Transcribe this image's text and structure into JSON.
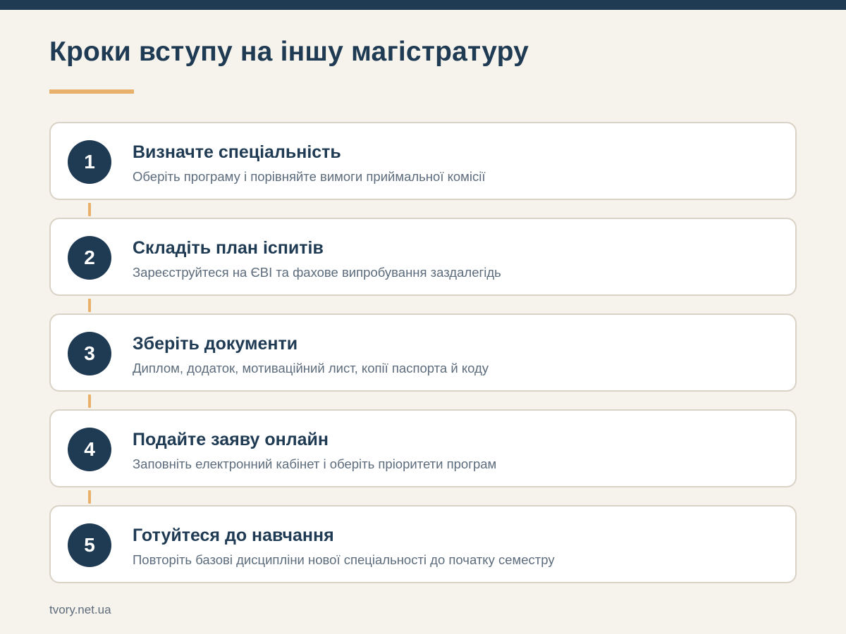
{
  "title": "Кроки вступу на іншу магістратуру",
  "colors": {
    "navy": "#1f3a53",
    "accent": "#e8b06a",
    "background": "#f6f2ec",
    "card": "#ffffff",
    "card_border": "#d9d2c5",
    "muted_text": "#5d6c7c"
  },
  "steps": [
    {
      "number": "1",
      "title": "Визначте спеціальність",
      "description": "Оберіть програму і порівняйте вимоги приймальної комісії"
    },
    {
      "number": "2",
      "title": "Складіть план іспитів",
      "description": "Зареєструйтеся на ЄВІ та фахове випробування заздалегідь"
    },
    {
      "number": "3",
      "title": "Зберіть документи",
      "description": "Диплом, додаток, мотиваційний лист, копії паспорта й коду"
    },
    {
      "number": "4",
      "title": "Подайте заяву онлайн",
      "description": "Заповніть електронний кабінет і оберіть пріоритети програм"
    },
    {
      "number": "5",
      "title": "Готуйтеся до навчання",
      "description": "Повторіть базові дисципліни нової спеціальності до початку семестру"
    }
  ],
  "footer": "tvory.net.ua"
}
